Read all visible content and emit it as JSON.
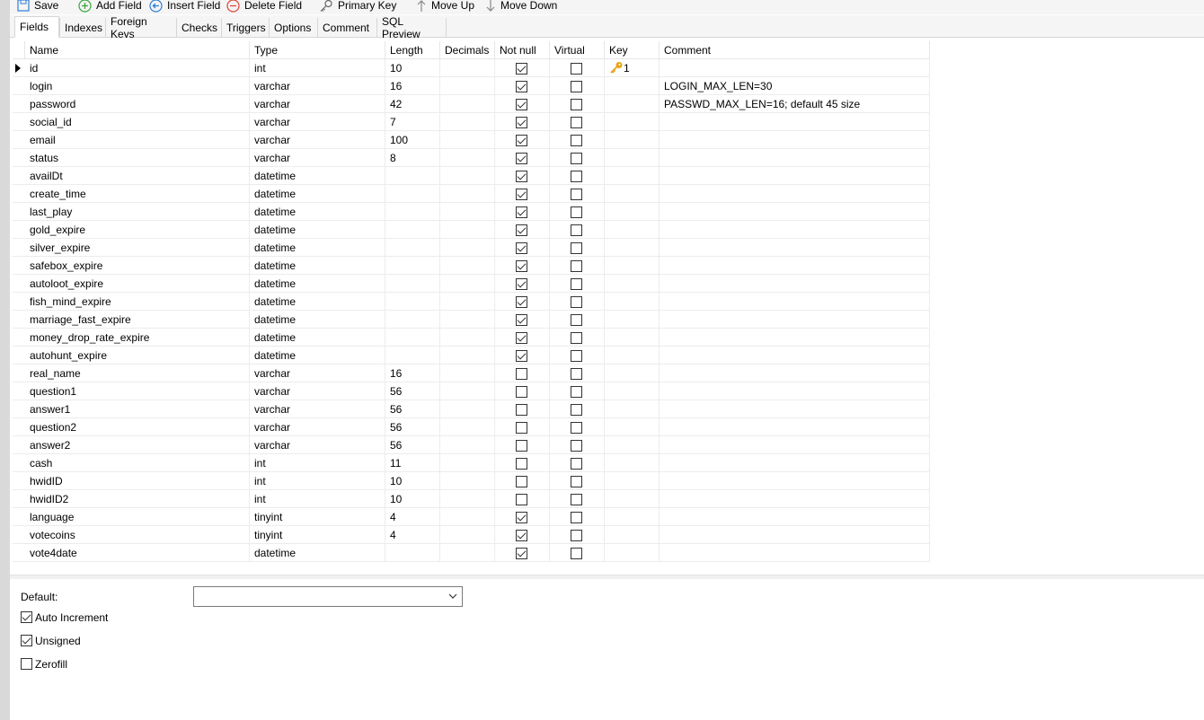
{
  "toolbar": {
    "save": "Save",
    "add_field": "Add Field",
    "insert_field": "Insert Field",
    "delete_field": "Delete Field",
    "primary_key": "Primary Key",
    "move_up": "Move Up",
    "move_down": "Move Down"
  },
  "tabs": [
    "Fields",
    "Indexes",
    "Foreign Keys",
    "Checks",
    "Triggers",
    "Options",
    "Comment",
    "SQL Preview"
  ],
  "active_tab": "Fields",
  "columns": [
    "Name",
    "Type",
    "Length",
    "Decimals",
    "Not null",
    "Virtual",
    "Key",
    "Comment"
  ],
  "rows": [
    {
      "name": "id",
      "type": "int",
      "length": "10",
      "decimals": "",
      "not_null": true,
      "virtual": false,
      "key": "1",
      "comment": ""
    },
    {
      "name": "login",
      "type": "varchar",
      "length": "16",
      "decimals": "",
      "not_null": true,
      "virtual": false,
      "key": "",
      "comment": "LOGIN_MAX_LEN=30"
    },
    {
      "name": "password",
      "type": "varchar",
      "length": "42",
      "decimals": "",
      "not_null": true,
      "virtual": false,
      "key": "",
      "comment": "PASSWD_MAX_LEN=16; default 45 size"
    },
    {
      "name": "social_id",
      "type": "varchar",
      "length": "7",
      "decimals": "",
      "not_null": true,
      "virtual": false,
      "key": "",
      "comment": ""
    },
    {
      "name": "email",
      "type": "varchar",
      "length": "100",
      "decimals": "",
      "not_null": true,
      "virtual": false,
      "key": "",
      "comment": ""
    },
    {
      "name": "status",
      "type": "varchar",
      "length": "8",
      "decimals": "",
      "not_null": true,
      "virtual": false,
      "key": "",
      "comment": ""
    },
    {
      "name": "availDt",
      "type": "datetime",
      "length": "",
      "decimals": "",
      "not_null": true,
      "virtual": false,
      "key": "",
      "comment": ""
    },
    {
      "name": "create_time",
      "type": "datetime",
      "length": "",
      "decimals": "",
      "not_null": true,
      "virtual": false,
      "key": "",
      "comment": ""
    },
    {
      "name": "last_play",
      "type": "datetime",
      "length": "",
      "decimals": "",
      "not_null": true,
      "virtual": false,
      "key": "",
      "comment": ""
    },
    {
      "name": "gold_expire",
      "type": "datetime",
      "length": "",
      "decimals": "",
      "not_null": true,
      "virtual": false,
      "key": "",
      "comment": ""
    },
    {
      "name": "silver_expire",
      "type": "datetime",
      "length": "",
      "decimals": "",
      "not_null": true,
      "virtual": false,
      "key": "",
      "comment": ""
    },
    {
      "name": "safebox_expire",
      "type": "datetime",
      "length": "",
      "decimals": "",
      "not_null": true,
      "virtual": false,
      "key": "",
      "comment": ""
    },
    {
      "name": "autoloot_expire",
      "type": "datetime",
      "length": "",
      "decimals": "",
      "not_null": true,
      "virtual": false,
      "key": "",
      "comment": ""
    },
    {
      "name": "fish_mind_expire",
      "type": "datetime",
      "length": "",
      "decimals": "",
      "not_null": true,
      "virtual": false,
      "key": "",
      "comment": ""
    },
    {
      "name": "marriage_fast_expire",
      "type": "datetime",
      "length": "",
      "decimals": "",
      "not_null": true,
      "virtual": false,
      "key": "",
      "comment": ""
    },
    {
      "name": "money_drop_rate_expire",
      "type": "datetime",
      "length": "",
      "decimals": "",
      "not_null": true,
      "virtual": false,
      "key": "",
      "comment": ""
    },
    {
      "name": "autohunt_expire",
      "type": "datetime",
      "length": "",
      "decimals": "",
      "not_null": true,
      "virtual": false,
      "key": "",
      "comment": ""
    },
    {
      "name": "real_name",
      "type": "varchar",
      "length": "16",
      "decimals": "",
      "not_null": false,
      "virtual": false,
      "key": "",
      "comment": ""
    },
    {
      "name": "question1",
      "type": "varchar",
      "length": "56",
      "decimals": "",
      "not_null": false,
      "virtual": false,
      "key": "",
      "comment": ""
    },
    {
      "name": "answer1",
      "type": "varchar",
      "length": "56",
      "decimals": "",
      "not_null": false,
      "virtual": false,
      "key": "",
      "comment": ""
    },
    {
      "name": "question2",
      "type": "varchar",
      "length": "56",
      "decimals": "",
      "not_null": false,
      "virtual": false,
      "key": "",
      "comment": ""
    },
    {
      "name": "answer2",
      "type": "varchar",
      "length": "56",
      "decimals": "",
      "not_null": false,
      "virtual": false,
      "key": "",
      "comment": ""
    },
    {
      "name": "cash",
      "type": "int",
      "length": "11",
      "decimals": "",
      "not_null": false,
      "virtual": false,
      "key": "",
      "comment": ""
    },
    {
      "name": "hwidID",
      "type": "int",
      "length": "10",
      "decimals": "",
      "not_null": false,
      "virtual": false,
      "key": "",
      "comment": ""
    },
    {
      "name": "hwidID2",
      "type": "int",
      "length": "10",
      "decimals": "",
      "not_null": false,
      "virtual": false,
      "key": "",
      "comment": ""
    },
    {
      "name": "language",
      "type": "tinyint",
      "length": "4",
      "decimals": "",
      "not_null": true,
      "virtual": false,
      "key": "",
      "comment": ""
    },
    {
      "name": "votecoins",
      "type": "tinyint",
      "length": "4",
      "decimals": "",
      "not_null": true,
      "virtual": false,
      "key": "",
      "comment": ""
    },
    {
      "name": "vote4date",
      "type": "datetime",
      "length": "",
      "decimals": "",
      "not_null": true,
      "virtual": false,
      "key": "",
      "comment": ""
    }
  ],
  "properties": {
    "default_label": "Default:",
    "default_value": "",
    "auto_increment_label": "Auto Increment",
    "auto_increment": true,
    "unsigned_label": "Unsigned",
    "unsigned": true,
    "zerofill_label": "Zerofill",
    "zerofill": false
  },
  "icons": {
    "save": "save-icon",
    "add": "add-circle-icon",
    "insert": "insert-arrow-icon",
    "delete": "delete-circle-icon",
    "primary_key": "key-icon",
    "move_up": "arrow-up-icon",
    "move_down": "arrow-down-icon"
  },
  "colors": {
    "add_green": "#3aa53a",
    "insert_blue": "#2f7fd6",
    "delete_red": "#e0443a",
    "key_gold": "#e8a317"
  }
}
